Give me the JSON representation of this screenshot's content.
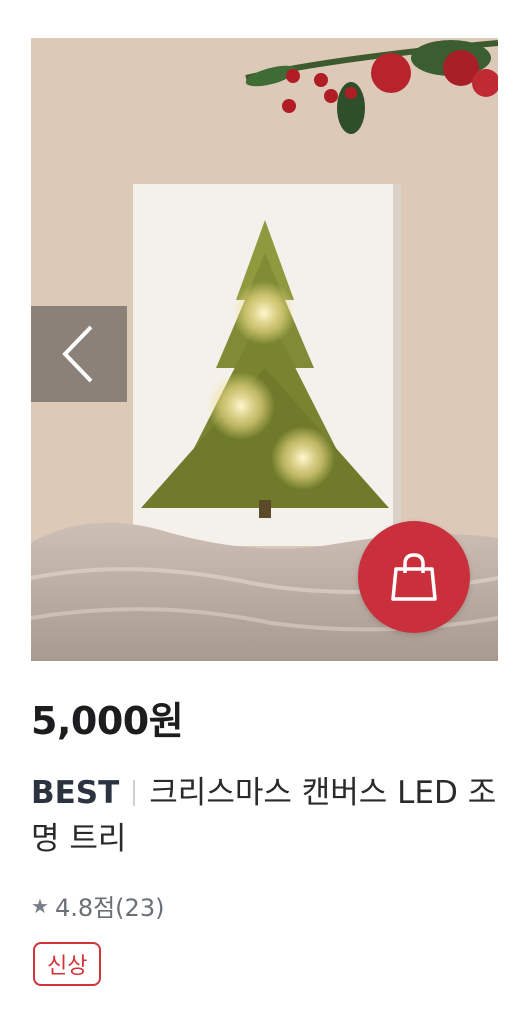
{
  "product": {
    "price": "5,000원",
    "label": "BEST",
    "name": "크리스마스 캔버스 LED 조명 트리",
    "rating": "4.8점(23)",
    "badge": "신상"
  },
  "icons": {
    "prev": "chevron-left-icon",
    "cart": "shopping-bag-icon",
    "star": "star-icon"
  },
  "colors": {
    "cart_button": "#c9303b",
    "badge": "#d0343a",
    "price": "#1d1d1f"
  }
}
